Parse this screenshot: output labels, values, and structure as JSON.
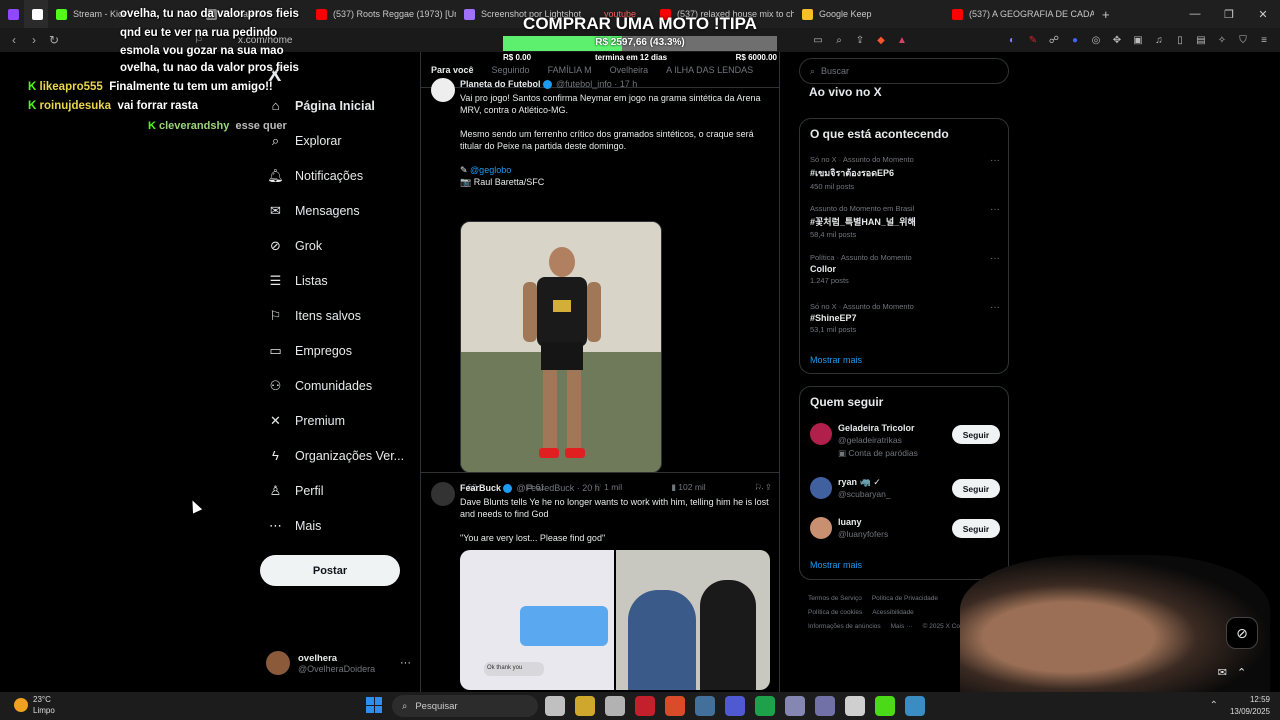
{
  "browser": {
    "tabs": [
      {
        "label": "",
        "color": "#9146ff"
      },
      {
        "label": "",
        "color": "#ffffff"
      },
      {
        "label": "Stream - Kick",
        "color": "#53fc18"
      },
      {
        "label": "ão marombi",
        "color": "#888888"
      },
      {
        "label": "(537) Roots Reggae (1973) [Unre",
        "color": "#ff0000"
      },
      {
        "label": "Screenshot por Lightshot",
        "color": "#a070ff"
      },
      {
        "label": "youtube",
        "color": "#ff0000"
      },
      {
        "label": "(537) relaxed house mix to chain",
        "color": "#ff0000"
      },
      {
        "label": "Google Keep",
        "color": "#f6bf26"
      },
      {
        "label": "(537) A GEOGRAFIA DE CADA ES",
        "color": "#ff0000"
      }
    ],
    "new_tab": "+",
    "url": "x.com/home"
  },
  "stream_overlay": {
    "chat": [
      {
        "user": "",
        "text": "ovelha, tu nao da valor pros fieis"
      },
      {
        "user": "",
        "text": "qnd eu te ver na rua pedindo"
      },
      {
        "user": "",
        "text": "esmola vou gozar na sua mao"
      },
      {
        "user": "",
        "text": "ovelha, tu nao da valor pros fieis"
      },
      {
        "user": "likeapro555",
        "text": "Finalmente tu tem um amigo!!"
      },
      {
        "user": "roinujdesuka",
        "text": "vai forrar rasta"
      },
      {
        "user": "cleverandshy",
        "text": "esse quer"
      }
    ],
    "goal": {
      "title": "COMPRAR UMA MOTO !TIPA",
      "progress_text": "R$ 2597,66 (43.3%)",
      "progress": 0.433,
      "min": "R$ 0.00",
      "ends": "termina em 12 dias",
      "max": "R$ 6000.00"
    }
  },
  "nav": {
    "logo": "X",
    "items": [
      {
        "label": "Página Inicial",
        "icon": "home-icon",
        "glyph": "⌂"
      },
      {
        "label": "Explorar",
        "icon": "search-icon",
        "glyph": "⌕"
      },
      {
        "label": "Notificações",
        "icon": "bell-icon",
        "glyph": "🔔︎"
      },
      {
        "label": "Mensagens",
        "icon": "mail-icon",
        "glyph": "✉"
      },
      {
        "label": "Grok",
        "icon": "grok-icon",
        "glyph": "⊘"
      },
      {
        "label": "Listas",
        "icon": "list-icon",
        "glyph": "☰"
      },
      {
        "label": "Itens salvos",
        "icon": "bookmark-icon",
        "glyph": "⚐"
      },
      {
        "label": "Empregos",
        "icon": "briefcase-icon",
        "glyph": "▭"
      },
      {
        "label": "Comunidades",
        "icon": "people-icon",
        "glyph": "⚇"
      },
      {
        "label": "Premium",
        "icon": "x-icon",
        "glyph": "✕"
      },
      {
        "label": "Organizações Ver...",
        "icon": "lightning-icon",
        "glyph": "ϟ"
      },
      {
        "label": "Perfil",
        "icon": "person-icon",
        "glyph": "♙"
      },
      {
        "label": "Mais",
        "icon": "more-circle-icon",
        "glyph": "⋯"
      }
    ],
    "post_label": "Postar",
    "account": {
      "name": "ovelhera",
      "handle": "@OvelheraDoidera"
    }
  },
  "feed": {
    "tabs": [
      "Para você",
      "Seguindo",
      "FAMÍLIA M",
      "Ovelheira",
      "A ILHA DAS LENDAS"
    ],
    "tweets": [
      {
        "name": "Planeta do Futebol",
        "handle": "@futebol_info · 17 h",
        "text1": "Vai pro jogo! Santos confirma Neymar em jogo na grama sintética da Arena MRV, contra o Atlético-MG.",
        "text2": "Mesmo sendo um ferrenho crítico dos gramados sintéticos, o craque será titular do Peixe na partida deste domingo.",
        "source": "@geglobo",
        "credit": "📷 Raul Baretta/SFC",
        "replies": "62",
        "retweets": "61",
        "likes": "1 mil",
        "views": "102 mil"
      },
      {
        "name": "FearBuck",
        "handle": "@FearedBuck · 20 h",
        "text1": "Dave Blunts tells Ye he no longer wants to work with him, telling him he is lost and needs to find God",
        "text2": "\"You are very lost... Please find god\"",
        "chat_bubble": "Ok thank you"
      }
    ]
  },
  "right": {
    "search_placeholder": "Buscar",
    "live_title": "Ao vivo no X",
    "trends_title": "O que está acontecendo",
    "trends": [
      {
        "context": "Só no X · Assunto do Momento",
        "name": "#เขมจิราต้องรอดEP6",
        "count": "450 mil posts"
      },
      {
        "context": "Assunto do Momento em Brasil",
        "name": "#꽃처럼_특별HAN_널_위해",
        "count": "58,4 mil posts"
      },
      {
        "context": "Política · Assunto do Momento",
        "name": "Collor",
        "count": "1.247 posts"
      },
      {
        "context": "Só no X · Assunto do Momento",
        "name": "#ShineEP7",
        "count": "53,1 mil posts"
      }
    ],
    "trends_more": "Mostrar mais",
    "follow_title": "Quem seguir",
    "follow": [
      {
        "name": "Geladeira Tricolor",
        "handle": "@geladeiratrikas",
        "sub": "Conta de paródias",
        "button": "Seguir",
        "color": "#b0204a"
      },
      {
        "name": "ryan 🦏 ✓",
        "handle": "@scubaryan_",
        "sub": "",
        "button": "Seguir",
        "color": "#4060a0"
      },
      {
        "name": "luany",
        "handle": "@luanyfofers",
        "sub": "",
        "button": "Seguir",
        "color": "#c89070"
      }
    ],
    "follow_more": "Mostrar mais",
    "footer": [
      "Termos de Serviço",
      "Política de Privacidade",
      "Política de cookies",
      "Acessibilidade",
      "Informações de anúncios",
      "Mais ···",
      "© 2025 X Corp."
    ]
  },
  "taskbar": {
    "temp": "23°C",
    "weather": "Limpo",
    "search": "Pesquisar",
    "time": "12:59",
    "date": "13/09/2025",
    "icons": [
      {
        "name": "task-view-icon",
        "color": "#dddddd"
      },
      {
        "name": "file-explorer-icon",
        "color": "#f0c030"
      },
      {
        "name": "chrome-icon",
        "color": "#cccccc"
      },
      {
        "name": "opera-icon",
        "color": "#e02030"
      },
      {
        "name": "brave-icon",
        "color": "#fb542b"
      },
      {
        "name": "steam-icon",
        "color": "#4a7fb0"
      },
      {
        "name": "discord-icon",
        "color": "#5865f2"
      },
      {
        "name": "spotify-icon",
        "color": "#1db954"
      },
      {
        "name": "app-icon",
        "color": "#9999cc"
      },
      {
        "name": "app2-icon",
        "color": "#8080c0"
      },
      {
        "name": "file-icon",
        "color": "#eeeeee"
      },
      {
        "name": "kick-icon",
        "color": "#53fc18"
      },
      {
        "name": "notepad-icon",
        "color": "#40a0e0"
      }
    ]
  }
}
